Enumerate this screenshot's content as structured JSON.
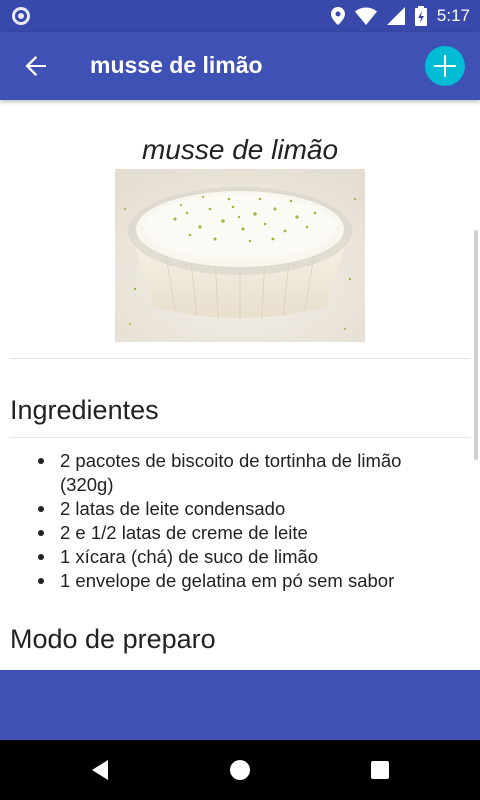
{
  "status_bar": {
    "time": "5:17",
    "icons": [
      "notification-icon",
      "location-icon",
      "wifi-icon",
      "cellular-icon",
      "battery-icon"
    ],
    "color": "#3949ab"
  },
  "app_bar": {
    "title": "musse de limão",
    "back_icon": "arrow-back-icon",
    "action_icon": "add-icon",
    "color": "#3f51b5",
    "fab_color": "#00bcd4"
  },
  "recipe": {
    "heading": "musse de limão",
    "ingredients_title": "Ingredientes",
    "ingredients": [
      "2 pacotes de biscoito de tortinha de limão (320g)",
      "2 latas de leite condensado",
      "2 e 1/2 latas de creme de leite",
      "1 xícara (chá) de suco de limão",
      "1 envelope de gelatina em pó sem sabor"
    ],
    "preparation_title": "Modo de preparo"
  },
  "nav_bar": {
    "buttons": [
      "back-triangle-icon",
      "home-circle-icon",
      "recents-square-icon"
    ]
  }
}
